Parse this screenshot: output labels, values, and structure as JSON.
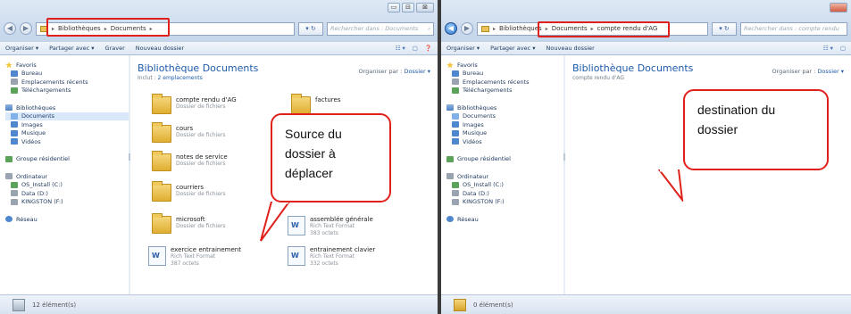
{
  "left_window": {
    "caption_buttons": [
      "▭",
      "⊟",
      "⊠"
    ],
    "address_crumbs": [
      "Bibliothèques",
      "Documents"
    ],
    "search_placeholder": "Rechercher dans : Documents",
    "toolbar": {
      "organize": "Organiser ▾",
      "share": "Partager avec ▾",
      "burn": "Graver",
      "new_folder": "Nouveau dossier"
    },
    "nav": {
      "favorites": "Favoris",
      "desktop": "Bureau",
      "recent_places": "Emplacements récents",
      "downloads": "Téléchargements",
      "libraries": "Bibliothèques",
      "documents": "Documents",
      "images": "Images",
      "music": "Musique",
      "videos": "Vidéos",
      "homegroup": "Groupe résidentiel",
      "computer": "Ordinateur",
      "drive_c": "OS_Install (C:)",
      "drive_d": "Data (D:)",
      "drive_f": "KINGSTON (F:)",
      "network": "Réseau"
    },
    "library_title": "Bibliothèque Documents",
    "library_subtitle_prefix": "Inclut :",
    "library_subtitle_link": "2 emplacements",
    "organize_by_label": "Organiser par :",
    "organize_by_value": "Dossier ▾",
    "files": [
      {
        "name": "compte rendu d'AG",
        "meta": "Dossier de fichiers"
      },
      {
        "name": "cours",
        "meta": "Dossier de fichiers"
      },
      {
        "name": "notes de service",
        "meta": "Dossier de fichiers"
      },
      {
        "name": "courriers",
        "meta": "Dossier de fichiers"
      },
      {
        "name": "microsoft",
        "meta": "Dossier de fichiers"
      },
      {
        "name": "exercice entrainement",
        "meta": "Rich Text Format",
        "size": "387 octets"
      },
      {
        "name": "factures",
        "meta": ""
      },
      {
        "name": "assemblée générale",
        "meta": "Rich Text Format",
        "size": "383 octets"
      },
      {
        "name": "entrainement clavier",
        "meta": "Rich Text Format",
        "size": "332 octets"
      }
    ],
    "status_count": "12 élément(s)",
    "callout": "Source du dossier à déplacer"
  },
  "right_window": {
    "address_crumbs": [
      "Bibliothèques",
      "Documents",
      "compte rendu d'AG"
    ],
    "search_placeholder": "Rechercher dans : compte rendu",
    "toolbar": {
      "organize": "Organiser ▾",
      "share": "Partager avec ▾",
      "new_folder": "Nouveau dossier"
    },
    "library_title": "Bibliothèque Documents",
    "library_subtitle": "compte rendu d'AG",
    "organize_by_label": "Organiser par :",
    "organize_by_value": "Dossier ▾",
    "status_count": "0 élément(s)",
    "callout": "destination du dossier"
  }
}
